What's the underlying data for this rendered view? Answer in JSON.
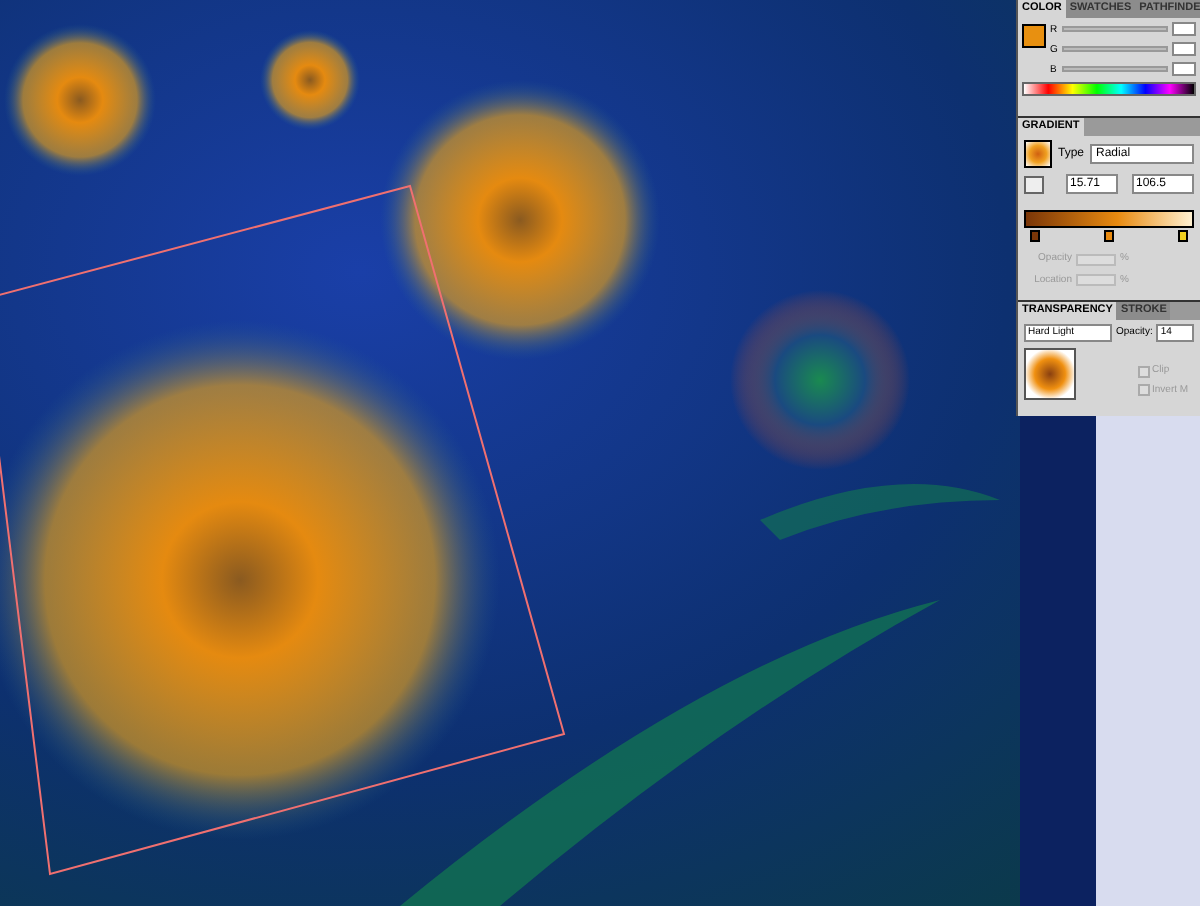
{
  "color_panel": {
    "tabs": [
      {
        "label": "COLOR",
        "selected": true
      },
      {
        "label": "SWATCHES",
        "selected": false
      },
      {
        "label": "PATHFINDE",
        "selected": false
      }
    ],
    "channels": [
      {
        "label": "R"
      },
      {
        "label": "G"
      },
      {
        "label": "B"
      }
    ]
  },
  "gradient_panel": {
    "tabs": [
      {
        "label": "GRADIENT",
        "selected": true
      }
    ],
    "type_label": "Type",
    "type_value": "Radial",
    "angle": "15.71",
    "aspect": "106.5",
    "stops": [
      {
        "color": "#7a3608"
      },
      {
        "color": "#e88a10"
      },
      {
        "color": "#f0d020"
      }
    ],
    "opacity_label": "Opacity",
    "opacity_unit": "%",
    "location_label": "Location",
    "location_unit": "%"
  },
  "transparency_panel": {
    "tabs": [
      {
        "label": "TRANSPARENCY",
        "selected": true
      },
      {
        "label": "STROKE",
        "selected": false
      }
    ],
    "blend_mode": "Hard Light",
    "opacity_label": "Opacity:",
    "opacity_value": "14",
    "options": [
      {
        "label": "Clip",
        "checked": false
      },
      {
        "label": "Invert M",
        "checked": false
      }
    ]
  }
}
